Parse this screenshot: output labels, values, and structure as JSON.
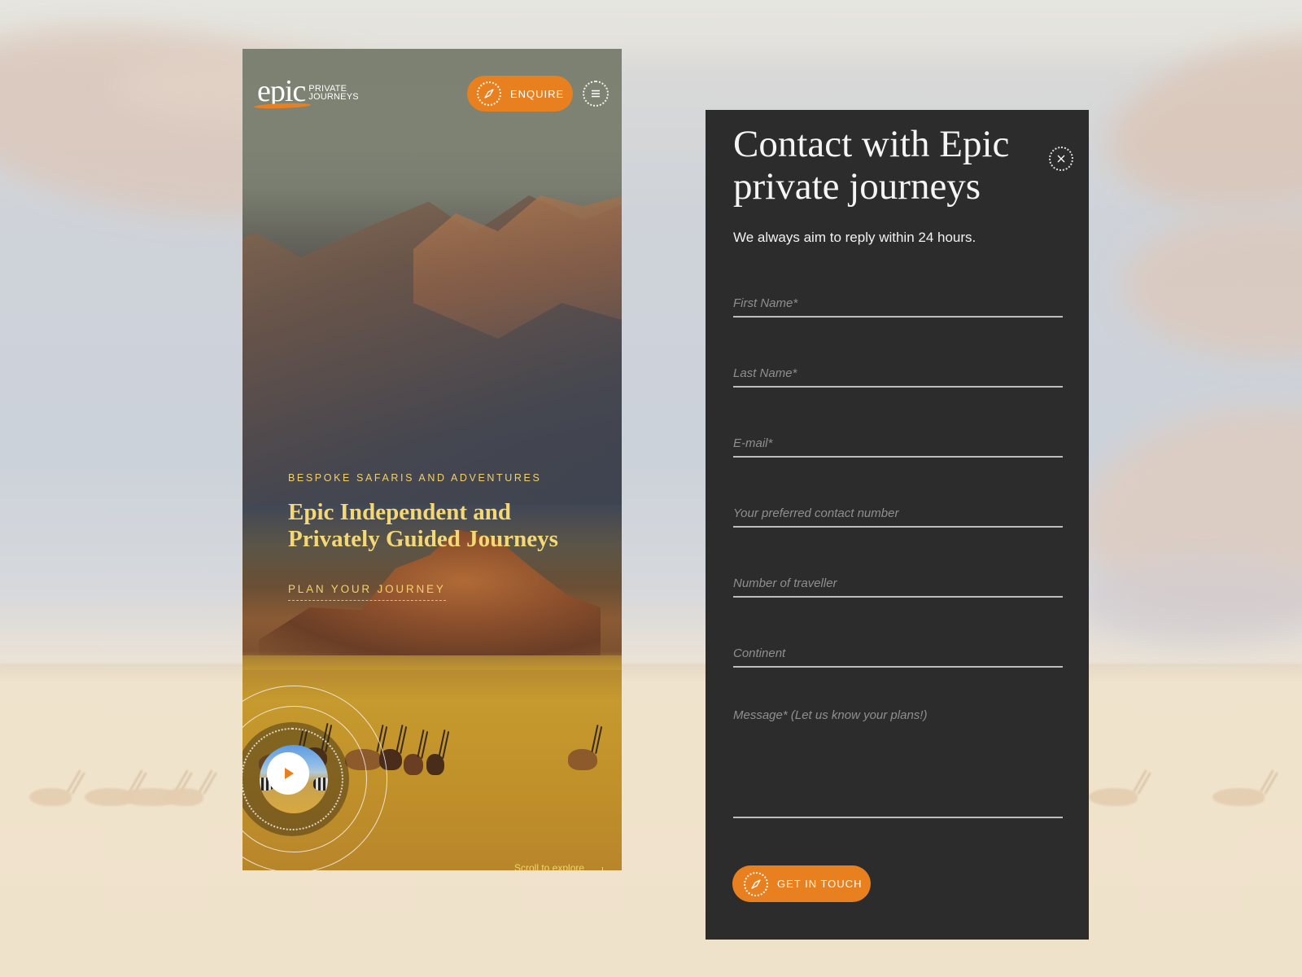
{
  "phone": {
    "logo": {
      "word": "epic",
      "sub_line1": "PRIVATE",
      "sub_line2": "JOURNEYS"
    },
    "enquire_label": "ENQUIRE",
    "icons": {
      "enquire": "compass-icon",
      "menu": "menu-icon",
      "play": "play-icon"
    },
    "eyebrow": "BESPOKE SAFARIS AND ADVENTURES",
    "title_line1": "Epic Independent and",
    "title_line2": "Privately Guided Journeys",
    "cta": "PLAN YOUR JOURNEY",
    "scroll_hint": "Scroll to explore"
  },
  "contact": {
    "title_line1": "Contact with Epic",
    "title_line2": "private journeys",
    "subtitle": "We always aim to reply within 24 hours.",
    "close_icon": "close-icon",
    "fields": [
      {
        "placeholder": "First Name*",
        "value": ""
      },
      {
        "placeholder": "Last Name*",
        "value": ""
      },
      {
        "placeholder": "E-mail*",
        "value": ""
      },
      {
        "placeholder": "Your preferred contact number",
        "value": ""
      },
      {
        "placeholder": "Number of traveller",
        "value": ""
      },
      {
        "placeholder": "Continent",
        "value": ""
      }
    ],
    "message_placeholder": "Message* (Let us know your plans!)",
    "submit_label": "GET IN TOUCH"
  },
  "colors": {
    "accent": "#e8801f",
    "panel_bg": "#2c2c2c",
    "hero_text": "#f4d875"
  }
}
